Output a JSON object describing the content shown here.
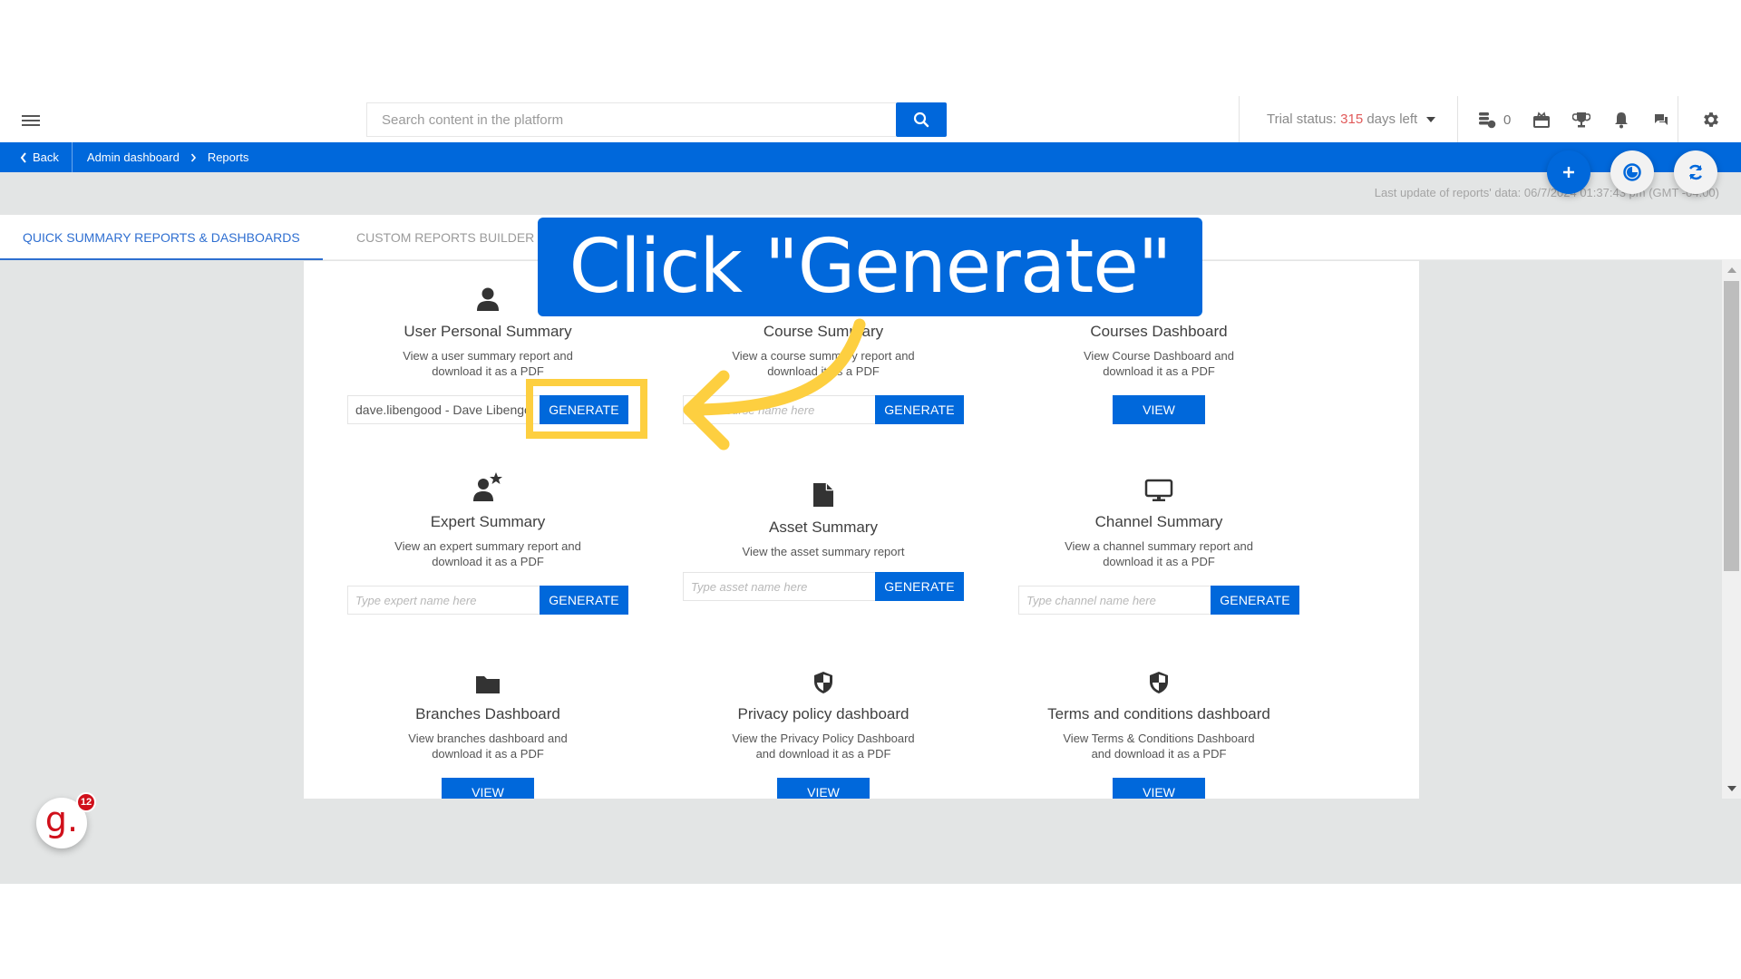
{
  "header": {
    "search": {
      "placeholder": "Search content in the platform",
      "button_icon": "search-icon"
    },
    "trial": {
      "prefix": "Trial status: ",
      "days": "315",
      "suffix": " days left"
    },
    "coins_count": "0",
    "icons": [
      "coins-icon",
      "gift-icon",
      "trophy-icon",
      "bell-icon",
      "chat-icon",
      "gear-icon"
    ]
  },
  "breadcrumb": {
    "back_label": "Back",
    "items": [
      "Admin dashboard",
      "Reports"
    ]
  },
  "fabs": {
    "add": "+",
    "theme_icon": "theme-icon",
    "refresh_icon": "refresh-icon"
  },
  "last_update": "Last update of reports' data: 06/7/2024 01:37:43 pm (GMT -04:00)",
  "tabs": [
    {
      "label": "QUICK SUMMARY REPORTS & DASHBOARDS",
      "active": true
    },
    {
      "label": "CUSTOM REPORTS BUILDER",
      "active": false
    }
  ],
  "cards": [
    {
      "title": "User Personal Summary",
      "desc1": "View a user summary report and",
      "desc2": "download it as a PDF",
      "input_value": "dave.libengood - Dave Libengood",
      "input_placeholder": "",
      "button": "GENERATE",
      "icon": "user-icon"
    },
    {
      "title": "Course Summary",
      "desc1": "View a course summary report and",
      "desc2": "download it as a PDF",
      "input_value": "",
      "input_placeholder": "Type course name here",
      "button": "GENERATE",
      "icon": "course-icon"
    },
    {
      "title": "Courses Dashboard",
      "desc1": "View Course Dashboard and",
      "desc2": "download it as a PDF",
      "button": "VIEW",
      "icon": "dashboard-icon"
    },
    {
      "title": "Expert Summary",
      "desc1": "View an expert summary report and",
      "desc2": "download it as a PDF",
      "input_value": "",
      "input_placeholder": "Type expert name here",
      "button": "GENERATE",
      "icon": "expert-icon"
    },
    {
      "title": "Asset Summary",
      "desc1": "View the asset summary report",
      "desc2": "",
      "input_value": "",
      "input_placeholder": "Type asset name here",
      "button": "GENERATE",
      "icon": "file-icon"
    },
    {
      "title": "Channel Summary",
      "desc1": "View a channel summary report and",
      "desc2": "download it as a PDF",
      "input_value": "",
      "input_placeholder": "Type channel name here",
      "button": "GENERATE",
      "icon": "monitor-icon"
    },
    {
      "title": "Branches Dashboard",
      "desc1": "View branches dashboard and",
      "desc2": "download it as a PDF",
      "button": "VIEW",
      "icon": "folder-icon"
    },
    {
      "title": "Privacy policy dashboard",
      "desc1": "View the Privacy Policy Dashboard",
      "desc2": "and download it as a PDF",
      "button": "VIEW",
      "icon": "shield-icon"
    },
    {
      "title": "Terms and conditions dashboard",
      "desc1": "View Terms & Conditions Dashboard",
      "desc2": "and download it as a PDF",
      "button": "VIEW",
      "icon": "shield-icon"
    }
  ],
  "badge": {
    "letter": "g.",
    "count": "12"
  },
  "overlay": {
    "callout_text": "Click \"Generate\"",
    "highlight_color": "#fdcf40",
    "callout_color": "#0168db"
  },
  "colors": {
    "primary": "#0068db",
    "trial_days": "#e15a5a"
  }
}
